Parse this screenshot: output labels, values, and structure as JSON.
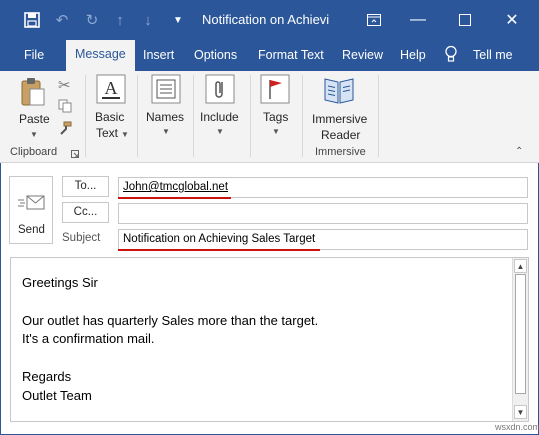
{
  "window": {
    "title": "Notification on Achievi"
  },
  "tabs": [
    {
      "label": "File"
    },
    {
      "label": "Message"
    },
    {
      "label": "Insert"
    },
    {
      "label": "Options"
    },
    {
      "label": "Format Text"
    },
    {
      "label": "Review"
    },
    {
      "label": "Help"
    },
    {
      "label": "Tell me"
    }
  ],
  "ribbon": {
    "paste": "Paste",
    "basic_text_1": "Basic",
    "basic_text_2": "Text",
    "names": "Names",
    "include": "Include",
    "tags": "Tags",
    "immersive_reader_1": "Immersive",
    "immersive_reader_2": "Reader",
    "group_clipboard": "Clipboard",
    "group_immersive": "Immersive"
  },
  "compose": {
    "send": "Send",
    "to_button": "To...",
    "cc_button": "Cc...",
    "subject_label": "Subject",
    "to_value": "John@tmcglobal.net",
    "cc_value": "",
    "subject_value": "Notification on Achieving Sales Target"
  },
  "body": {
    "lines": [
      "Greetings Sir",
      "Our outlet has quarterly Sales more than the target.",
      "It's a confirmation mail.",
      "Regards",
      "Outlet Team"
    ]
  },
  "watermark": "wsxdn.com",
  "colors": {
    "accent": "#2b579a",
    "highlight_underline": "#cc1111"
  }
}
